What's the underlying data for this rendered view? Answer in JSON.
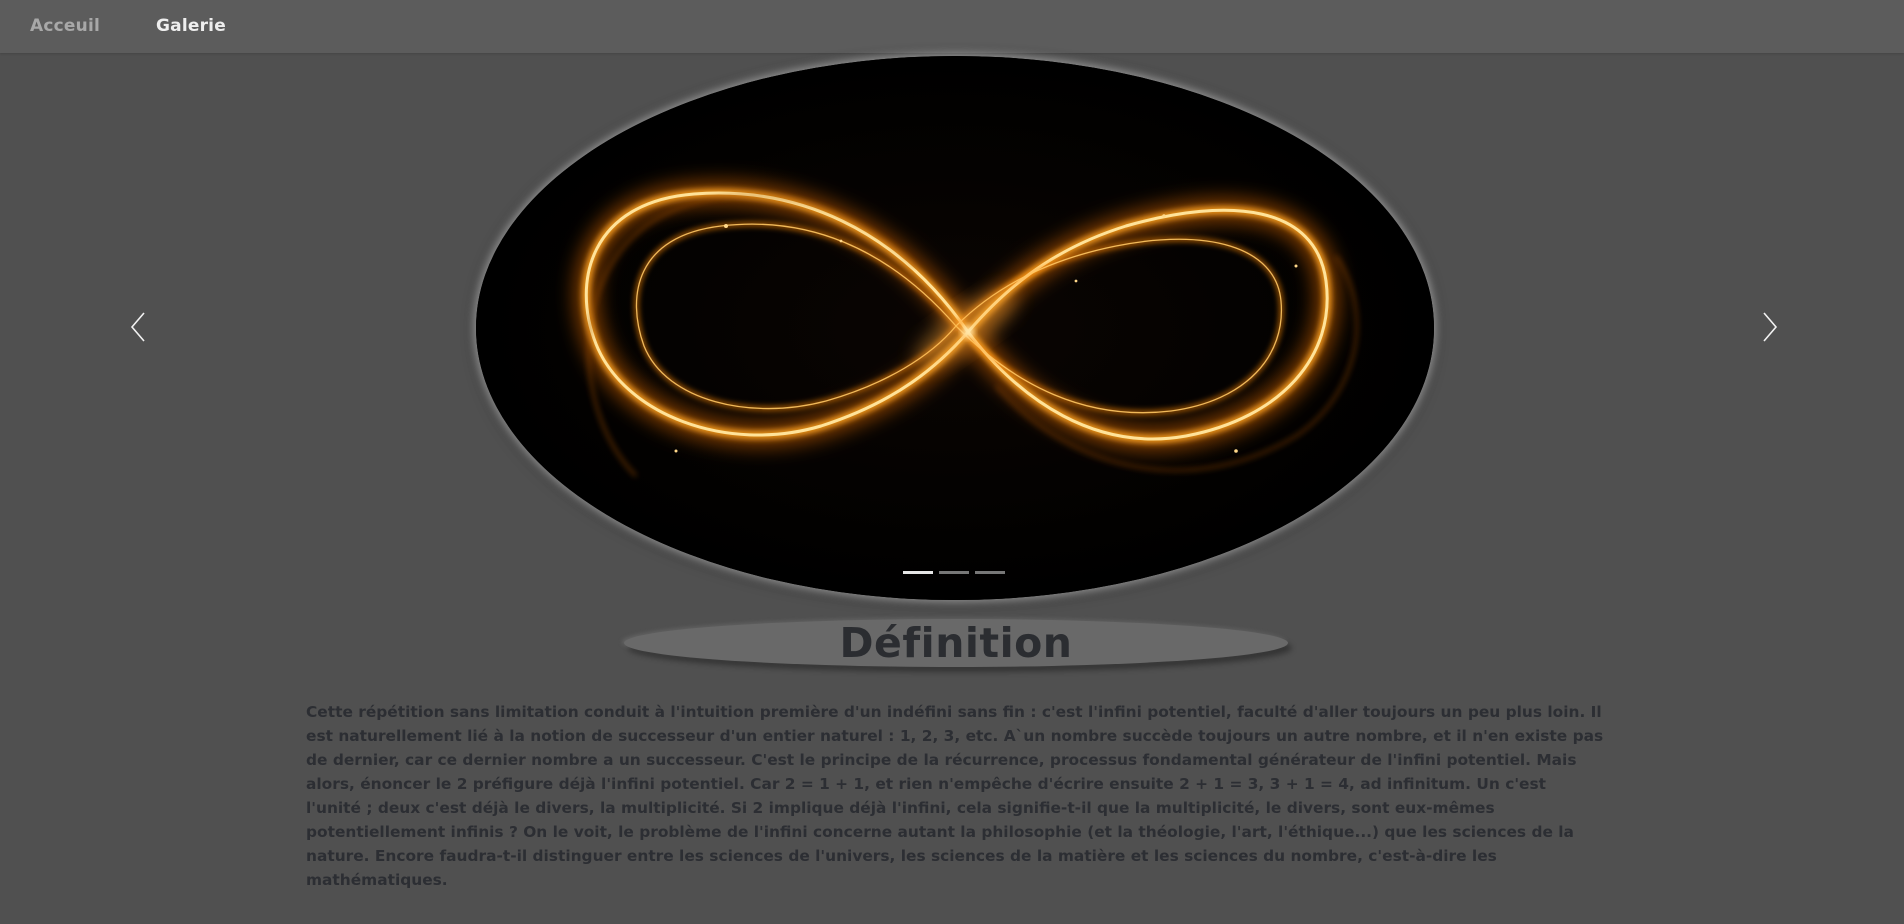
{
  "nav": {
    "items": [
      {
        "label": "Acceuil"
      },
      {
        "label": "Galerie"
      }
    ]
  },
  "carousel": {
    "slide_image": "glowing-infinity-symbol",
    "indicator_count": 3,
    "active_index": 0,
    "prev_icon": "chevron-left-icon",
    "next_icon": "chevron-right-icon"
  },
  "section": {
    "title": "Définition",
    "body": "Cette répétition sans limitation conduit à l'intuition première d'un indéfini sans fin : c'est l'infini potentiel, faculté d'aller toujours un peu plus loin. Il est naturellement lié à la notion de successeur d'un entier naturel : 1, 2, 3, etc. A`un nombre succède toujours un autre nombre, et il n'en existe pas de dernier, car ce dernier nombre a un successeur. C'est le principe de la récurrence, processus fondamental générateur de l'infini potentiel. Mais alors, énoncer le 2 préfigure déjà l'infini potentiel. Car 2 = 1 + 1, et rien n'empêche d'écrire ensuite 2 + 1 = 3, 3 + 1 = 4, ad infinitum. Un c'est l'unité ; deux c'est déjà le divers, la multiplicité. Si 2 implique déjà l'infini, cela signifie-t-il que la multiplicité, le divers, sont eux-mêmes potentiellement infinis ? On le voit, le problème de l'infini concerne autant la philosophie (et la théologie, l'art, l'éthique...) que les sciences de la nature. Encore faudra-t-il distinguer entre les sciences de l'univers, les sciences de la matière et les sciences du nombre, c'est-à-dire les mathématiques."
  },
  "colors": {
    "background": "#505050",
    "navbar": "#5c5c5c",
    "nav_active": "#eeeeee",
    "nav_inactive": "#a8a8a8",
    "text": "#2c2e33",
    "glow": "#ff9a1a"
  }
}
